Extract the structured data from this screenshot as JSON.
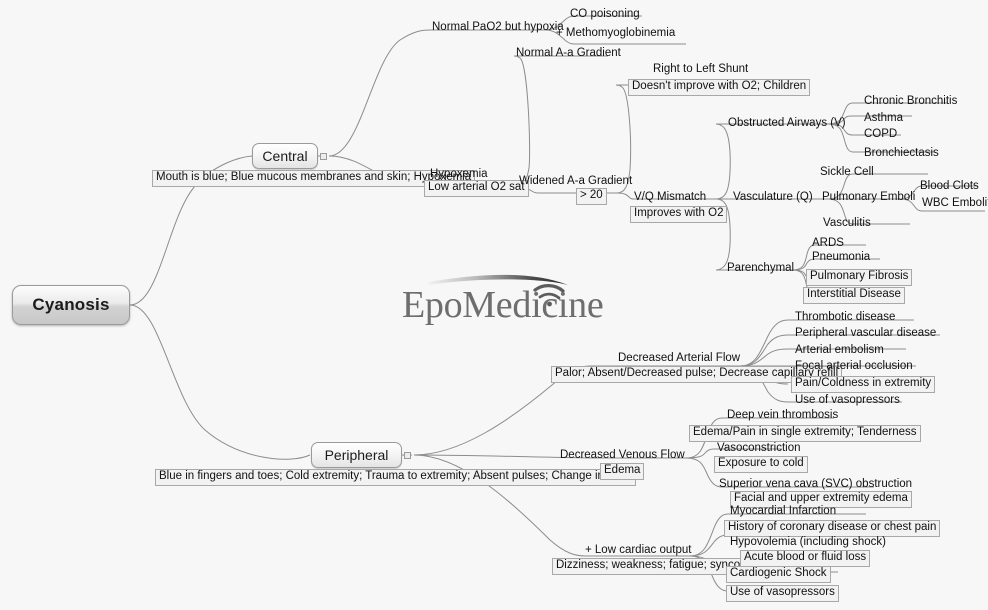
{
  "title": "Cyanosis mind map",
  "watermark": {
    "text": "EpoMedicine",
    "icon": "wifi-arc-icon"
  },
  "colors": {
    "background": "#f7f7f7",
    "connector": "#8c8c8c",
    "node_border": "#9a9a9a",
    "note_background": "#f2f2f2",
    "text": "#111111"
  },
  "root": {
    "label": "Cyanosis"
  },
  "branches": [
    {
      "id": "central",
      "label": "Central",
      "note": "Mouth is blue; Blue mucous membranes and skin; Hypoxemia",
      "children": [
        {
          "label": "Normal PaO2 but hypoxia",
          "children": [
            {
              "label": "CO poisoning"
            },
            {
              "label": "+ Methomyoglobinemia"
            }
          ]
        },
        {
          "label": "Hypoxemia",
          "note": "Low arterial O2 sat",
          "children": [
            {
              "label": "Normal A-a Gradient"
            },
            {
              "label": "Widened A-a Gradient",
              "note": "> 20",
              "children": [
                {
                  "label": "Right to Left Shunt",
                  "note": "Doesn't improve with O2; Children"
                },
                {
                  "label": "V/Q Mismatch",
                  "note": "Improves with O2",
                  "children": [
                    {
                      "label": "Obstructed Airways (V)",
                      "children": [
                        {
                          "label": "Chronic Bronchitis"
                        },
                        {
                          "label": "Asthma"
                        },
                        {
                          "label": "COPD"
                        },
                        {
                          "label": "Bronchiectasis"
                        }
                      ]
                    },
                    {
                      "label": "Vasculature (Q)",
                      "children": [
                        {
                          "label": "Sickle Cell"
                        },
                        {
                          "label": "Pulmonary Emboli",
                          "children": [
                            {
                              "label": "Blood Clots"
                            },
                            {
                              "label": "WBC Emboli?"
                            }
                          ]
                        },
                        {
                          "label": "Vasculitis"
                        }
                      ]
                    },
                    {
                      "label": "Parenchymal",
                      "children": [
                        {
                          "label": "ARDS"
                        },
                        {
                          "label": "Pneumonia"
                        },
                        {
                          "label": "Pulmonary Fibrosis"
                        },
                        {
                          "label": "Interstitial Disease"
                        }
                      ]
                    }
                  ]
                }
              ]
            }
          ]
        }
      ]
    },
    {
      "id": "peripheral",
      "label": "Peripheral",
      "note": "Blue in fingers and toes; Cold extremity; Trauma to extremity; Absent pulses; Change in color",
      "children": [
        {
          "label": "Decreased Arterial Flow",
          "note": "Palor; Absent/Decreased pulse; Decrease capillary refill",
          "children": [
            {
              "label": "Thrombotic disease"
            },
            {
              "label": "Peripheral vascular disease"
            },
            {
              "label": "Arterial embolism"
            },
            {
              "label": "Focal arterial occlusion"
            },
            {
              "label": "Pain/Coldness in extremity",
              "boxed": true
            },
            {
              "label": "Use of vasopressors"
            }
          ]
        },
        {
          "label": "Decreased Venous Flow",
          "note": "Edema",
          "children": [
            {
              "label": "Deep vein thrombosis",
              "note": "Edema/Pain in single extremity; Tenderness"
            },
            {
              "label": "Vasoconstriction",
              "note": "Exposure to cold"
            },
            {
              "label": "Superior vena cava (SVC) obstruction",
              "note": "Facial and upper extremity edema"
            }
          ]
        },
        {
          "label": "+ Low cardiac output",
          "note": "Dizziness; weakness; fatigue; syncope",
          "children": [
            {
              "label": "Myocardial Infarction",
              "note": "History of coronary disease or chest pain"
            },
            {
              "label": "Hypovolemia (including shock)",
              "note": "Acute blood or fluid loss"
            },
            {
              "label": "Cardiogenic Shock"
            },
            {
              "label": "Use of vasopressors"
            }
          ]
        }
      ]
    }
  ],
  "nodes": {
    "root_label": "Cyanosis",
    "central_label": "Central",
    "central_note": "Mouth is blue; Blue mucous membranes and skin; Hypoxemia",
    "normal_pao2": "Normal PaO2 but hypoxia",
    "co_poisoning": "CO poisoning",
    "methomyoglobinemia": "+ Methomyoglobinemia",
    "hypoxemia": "Hypoxemia",
    "hypoxemia_note": "Low arterial O2 sat",
    "normal_aa": "Normal A-a Gradient",
    "widened_aa": "Widened A-a Gradient",
    "widened_aa_note": "> 20",
    "right_to_left": "Right to Left Shunt",
    "right_to_left_note": "Doesn't improve with O2; Children",
    "vq_mismatch": "V/Q Mismatch",
    "vq_mismatch_note": "Improves with O2",
    "obstructed": "Obstructed Airways (V)",
    "chronic_bronchitis": "Chronic Bronchitis",
    "asthma": "Asthma",
    "copd": "COPD",
    "bronchiectasis": "Bronchiectasis",
    "vasculature": "Vasculature (Q)",
    "sickle_cell": "Sickle Cell",
    "pulmonary_emboli": "Pulmonary Emboli",
    "blood_clots": "Blood Clots",
    "wbc_emboli": "WBC Emboli?",
    "vasculitis": "Vasculitis",
    "parenchymal": "Parenchymal",
    "ards": "ARDS",
    "pneumonia": "Pneumonia",
    "pulmonary_fibrosis": "Pulmonary Fibrosis",
    "interstitial": "Interstitial Disease",
    "peripheral_label": "Peripheral",
    "peripheral_note": "Blue in fingers and toes; Cold extremity; Trauma to extremity; Absent pulses; Change in color",
    "dec_arterial": "Decreased Arterial Flow",
    "dec_arterial_note": "Palor; Absent/Decreased pulse; Decrease capillary refill",
    "thrombotic": "Thrombotic disease",
    "pvd": "Peripheral vascular disease",
    "arterial_embolism": "Arterial embolism",
    "focal_occlusion": "Focal arterial occlusion",
    "pain_coldness": "Pain/Coldness in extremity",
    "vasopressors_a": "Use of vasopressors",
    "dec_venous": "Decreased Venous Flow",
    "dec_venous_note": "Edema",
    "dvt": "Deep vein thrombosis",
    "dvt_note": "Edema/Pain in single extremity; Tenderness",
    "vasoconstriction": "Vasoconstriction",
    "vasoconstriction_note": "Exposure to cold",
    "svc": "Superior vena cava (SVC) obstruction",
    "svc_note": "Facial and upper extremity edema",
    "low_cardiac": "+ Low cardiac output",
    "low_cardiac_note": "Dizziness; weakness; fatigue; syncope",
    "mi": "Myocardial Infarction",
    "mi_note": "History of coronary disease or chest pain",
    "hypovolemia": "Hypovolemia (including shock)",
    "hypovolemia_note": "Acute blood or fluid loss",
    "cardiogenic_shock": "Cardiogenic Shock",
    "vasopressors_c": "Use of vasopressors"
  }
}
